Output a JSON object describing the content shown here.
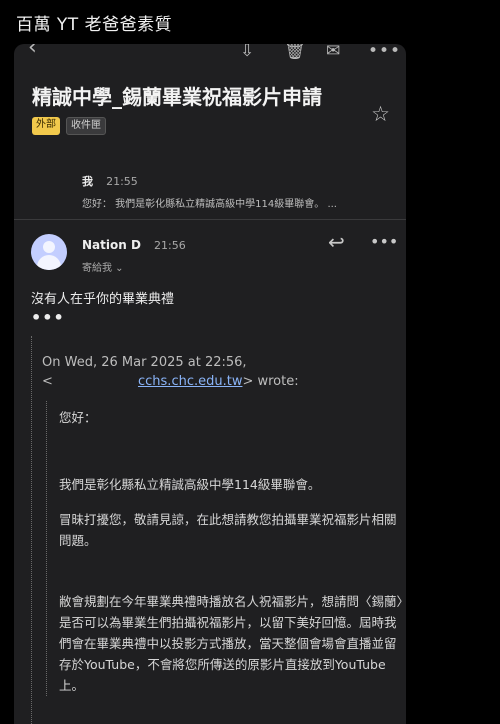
{
  "page_title": "百萬 YT 老爸爸素質",
  "toolbar": {
    "back_glyph": "‹",
    "archive_glyph": "⇩",
    "trash_glyph": "🗑",
    "mail_glyph": "✉",
    "more_glyph": "•••"
  },
  "email": {
    "subject": "精誠中學_錫蘭畢業祝福影片申請",
    "labels": [
      "外部",
      "收件匣"
    ],
    "star_glyph": "☆"
  },
  "collapsed_message": {
    "sender": "我",
    "time": "21:55",
    "snippet": "您好： 我們是彰化縣私立精誠高級中學114級畢聯會。 ..."
  },
  "open_message": {
    "sender": "Nation D",
    "time": "21:56",
    "recipient": "寄給我 ⌄",
    "reply_glyph": "↩",
    "more_glyph": "•••",
    "body": "沒有人在乎你的畢業典禮",
    "ellipsis": "•••"
  },
  "quoted": {
    "header_line": "On Wed, 26 Mar 2025 at 22:56,",
    "lt": "<",
    "email_domain": "cchs.chc.edu.tw",
    "wrote": "> wrote:",
    "greeting": "您好：",
    "paragraphs": [
      "我們是彰化縣私立精誠高級中學114級畢聯會。",
      "冒昧打擾您，敬請見諒，在此想請教您拍攝畢業祝福影片相關問題。",
      "敝會規劃在今年畢業典禮時播放名人祝福影片，想請問〈錫蘭〉是否可以為畢業生們拍攝祝福影片，以留下美好回憶。屆時我們會在畢業典禮中以投影方式播放，當天整個會場會直播並留存於YouTube，不會將您所傳送的原影片直接放到YouTube上。"
    ]
  }
}
